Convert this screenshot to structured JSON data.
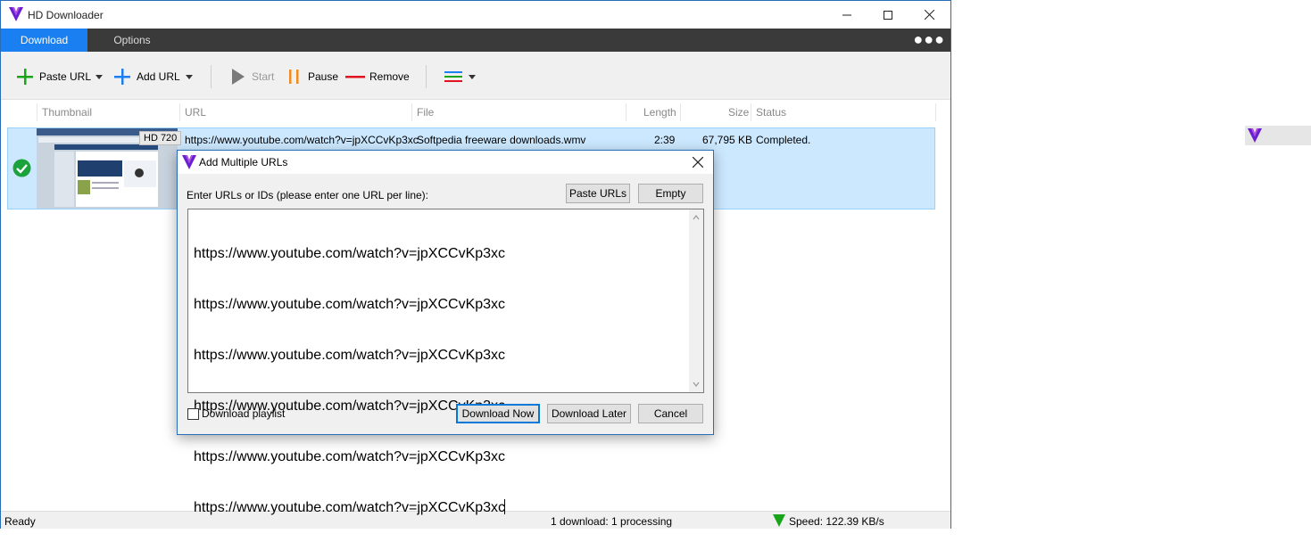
{
  "window": {
    "title": "HD Downloader",
    "controls": {
      "minimize": "minimize",
      "maximize": "maximize",
      "close": "close"
    }
  },
  "tabs": [
    {
      "label": "Download",
      "active": true
    },
    {
      "label": "Options",
      "active": false
    }
  ],
  "more_menu_icon": "more-icon",
  "toolbar": {
    "paste_url": "Paste URL",
    "add_url": "Add URL",
    "start": "Start",
    "pause": "Pause",
    "remove": "Remove"
  },
  "columns": {
    "thumbnail": "Thumbnail",
    "url": "URL",
    "file": "File",
    "length": "Length",
    "size": "Size",
    "status": "Status"
  },
  "downloads": [
    {
      "quality": "HD 720",
      "url": "https://www.youtube.com/watch?v=jpXCCvKp3xc",
      "file": "Softpedia freeware downloads.wmv",
      "length": "2:39",
      "size": "67,795 KB",
      "status": "Completed."
    }
  ],
  "dialog": {
    "title": "Add Multiple URLs",
    "prompt": "Enter URLs or IDs (please enter one URL per line):",
    "paste_urls": "Paste URLs",
    "empty": "Empty",
    "url_lines": [
      "https://www.youtube.com/watch?v=jpXCCvKp3xc",
      "https://www.youtube.com/watch?v=jpXCCvKp3xc",
      "https://www.youtube.com/watch?v=jpXCCvKp3xc",
      "https://www.youtube.com/watch?v=jpXCCvKp3xc",
      "https://www.youtube.com/watch?v=jpXCCvKp3xc",
      "https://www.youtube.com/watch?v=jpXCCvKp3xc"
    ],
    "download_playlist": "Download playlist",
    "download_playlist_checked": false,
    "download_now": "Download Now",
    "download_later": "Download Later",
    "cancel": "Cancel"
  },
  "statusbar": {
    "left": "Ready",
    "center": "1 download: 1 processing",
    "speed": "Speed: 122.39 KB/s"
  },
  "colors": {
    "accent": "#1a7ff0",
    "tabbar": "#3a3a3a",
    "selected_row": "#cce8ff",
    "logo_purple": "#6a1fd0",
    "plus_green": "#19a519",
    "plus_blue": "#1a7ff0",
    "pause_orange": "#f08c1e",
    "remove_red": "#e0141e"
  }
}
